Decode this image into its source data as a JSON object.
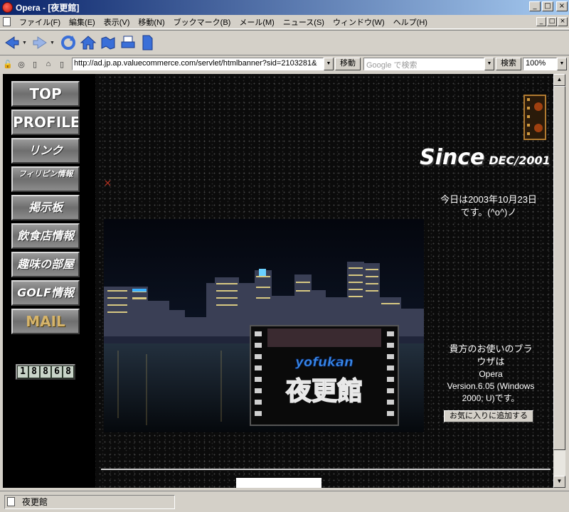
{
  "window": {
    "title": "Opera - [夜更館]",
    "minimize": "_",
    "maximize": "□",
    "close": "×"
  },
  "menu": [
    "ファイル(F)",
    "編集(E)",
    "表示(V)",
    "移動(N)",
    "ブックマーク(B)",
    "メール(M)",
    "ニュース(S)",
    "ウィンドウ(W)",
    "ヘルプ(H)"
  ],
  "address": {
    "url": "http://ad.jp.ap.valuecommerce.com/servlet/htmlbanner?sid=2103281&",
    "go_label": "移動",
    "search_placeholder": "Google で検索",
    "search_label": "検索",
    "zoom": "100%"
  },
  "sidebar": {
    "items": [
      "TOP",
      "PROFILE",
      "リンク",
      "フィリピン情報",
      "掲示板",
      "飲食店情報",
      "趣味の部屋",
      "GOLF情報",
      "MAIL"
    ]
  },
  "counter": "18868",
  "header": {
    "since": "Since",
    "since_date": "DEC/2001",
    "date_line1": "今日は2003年10月23日",
    "date_line2": "です。(^o^)ノ"
  },
  "photo": {
    "logo_roman": "yofukan",
    "logo_kanji": "夜更館"
  },
  "browser_info": {
    "line1": "貴方のお使いのブラ",
    "line2": "ウザは",
    "line3": "Opera",
    "line4": "Version.6.05 (Windows",
    "line5": "2000; U)です。",
    "fav_button": "お気に入りに追加する"
  },
  "status": {
    "text": "夜更館"
  },
  "colors": {
    "titlebar_start": "#0a246a",
    "titlebar_end": "#a6caf0",
    "chrome": "#d4d0c8",
    "page_bg": "#0b0b0b"
  }
}
